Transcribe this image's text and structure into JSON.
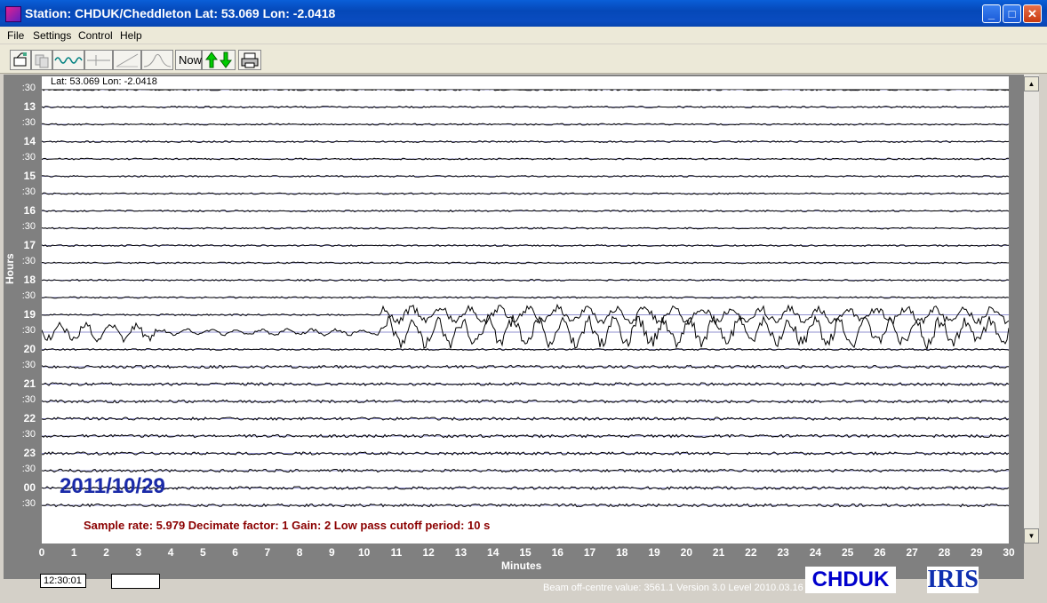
{
  "window": {
    "title": "Station: CHDUK/Cheddleton Lat: 53.069 Lon: -2.0418",
    "minimize_icon": "minimize-icon",
    "maximize_icon": "maximize-icon",
    "close_icon": "close-icon"
  },
  "menu": [
    {
      "label": "File"
    },
    {
      "label": "Settings"
    },
    {
      "label": "Control"
    },
    {
      "label": "Help"
    }
  ],
  "toolbar": {
    "now_label": "Now",
    "icons": [
      "open-file-icon",
      "copy-icon",
      "waveform-icon",
      "trace-icon",
      "ramp-icon",
      "pulse-icon",
      "now-button",
      "scroll-up-down-icon",
      "print-icon"
    ]
  },
  "plot": {
    "lat_lon": "Lat: 53.069 Lon: -2.0418",
    "date": "2011/10/29",
    "info": "Sample rate: 5.979  Decimate factor: 1  Gain: 2  Low pass cutoff period: 10 s",
    "y_title": "Hours",
    "x_title": "Minutes",
    "row_labels": [
      ":30",
      "13",
      ":30",
      "14",
      ":30",
      "15",
      ":30",
      "16",
      ":30",
      "17",
      ":30",
      "18",
      ":30",
      "19",
      ":30",
      "20",
      ":30",
      "21",
      ":30",
      "22",
      ":30",
      "23",
      ":30",
      "00",
      ":30"
    ],
    "x_ticks": [
      "0",
      "1",
      "2",
      "3",
      "4",
      "5",
      "6",
      "7",
      "8",
      "9",
      "10",
      "11",
      "12",
      "13",
      "14",
      "15",
      "16",
      "17",
      "18",
      "19",
      "20",
      "21",
      "22",
      "23",
      "24",
      "25",
      "26",
      "27",
      "28",
      "29",
      "30"
    ],
    "trace_color": "#000000",
    "baseline_color": "#2020a0",
    "date_color": "#1a2aa8",
    "info_color": "#8b0000"
  },
  "status": {
    "time": "12:30:01",
    "beam": "Beam off-centre value: 3561.1",
    "version": "Version 3.0 Level 2010.03.16",
    "station": "CHDUK",
    "logo": "IRIS"
  }
}
